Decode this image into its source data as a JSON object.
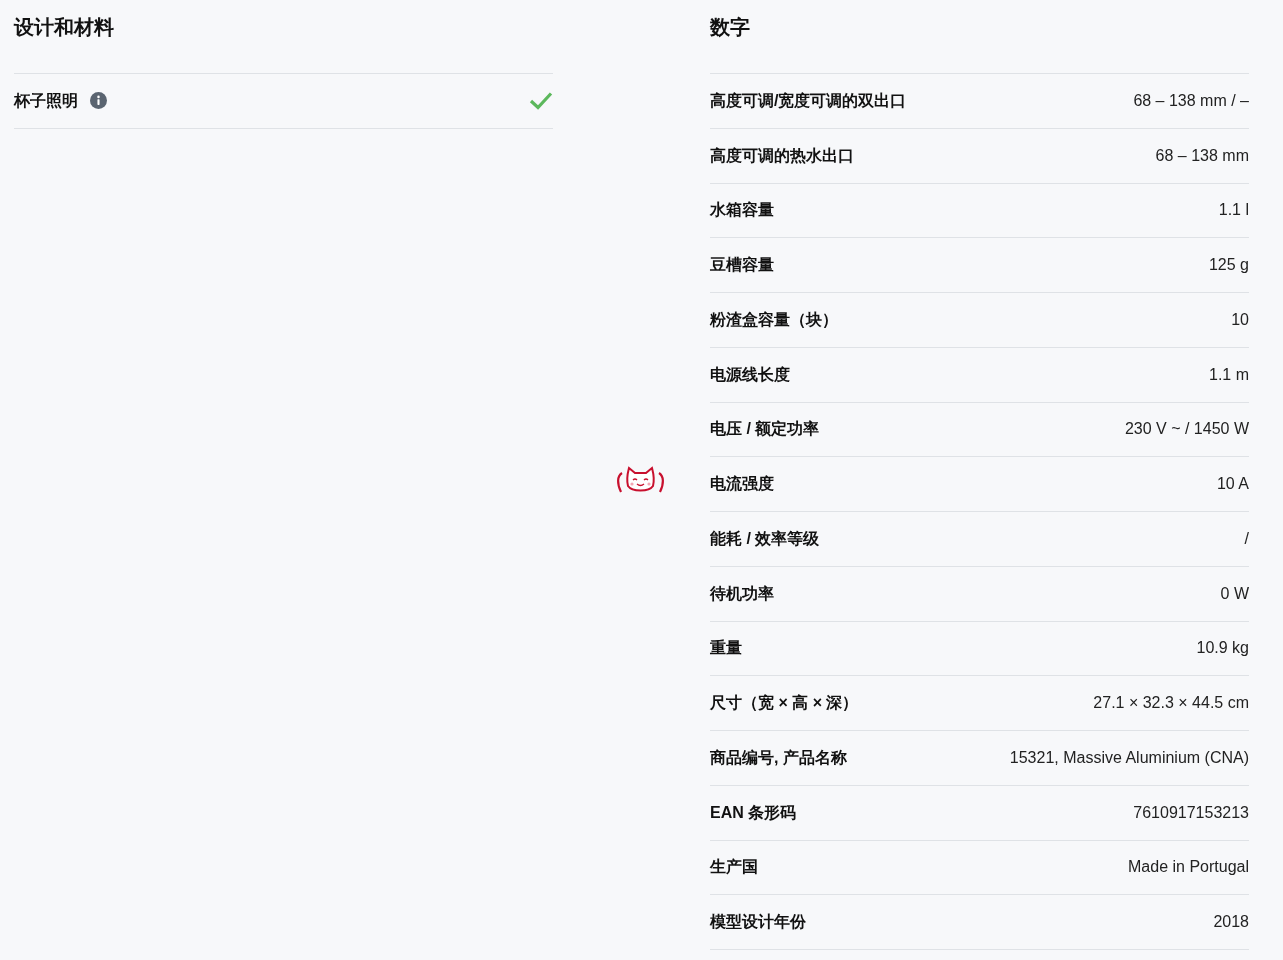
{
  "sections": [
    {
      "title": "设计和材料",
      "rows": [
        {
          "label": "杯子照明",
          "info": true,
          "checked": true
        }
      ]
    },
    {
      "title": "数字",
      "rows": [
        {
          "label": "高度可调/宽度可调的双出口",
          "value": "68 – 138 mm / –"
        },
        {
          "label": "高度可调的热水出口",
          "value": "68 – 138 mm"
        },
        {
          "label": "水箱容量",
          "value": "1.1 l"
        },
        {
          "label": "豆槽容量",
          "value": "125 g"
        },
        {
          "label": "粉渣盒容量（块）",
          "value": "10"
        },
        {
          "label": "电源线长度",
          "value": "1.1 m"
        },
        {
          "label": "电压 / 额定功率",
          "value": "230 V ~ / 1450 W"
        },
        {
          "label": "电流强度",
          "value": "10 A"
        },
        {
          "label": "能耗 / 效率等级",
          "value": "/"
        },
        {
          "label": "待机功率",
          "value": "0 W"
        },
        {
          "label": "重量",
          "value": "10.9 kg"
        },
        {
          "label": "尺寸（宽 × 高 × 深）",
          "value": "27.1 × 32.3 × 44.5 cm"
        },
        {
          "label": "商品编号, 产品名称",
          "value": "15321, Massive Aluminium (CNA)"
        },
        {
          "label": "EAN 条形码",
          "value": "7610917153213"
        },
        {
          "label": "生产国",
          "value": "Made in Portugal"
        },
        {
          "label": "模型设计年份",
          "value": "2018"
        }
      ]
    }
  ]
}
